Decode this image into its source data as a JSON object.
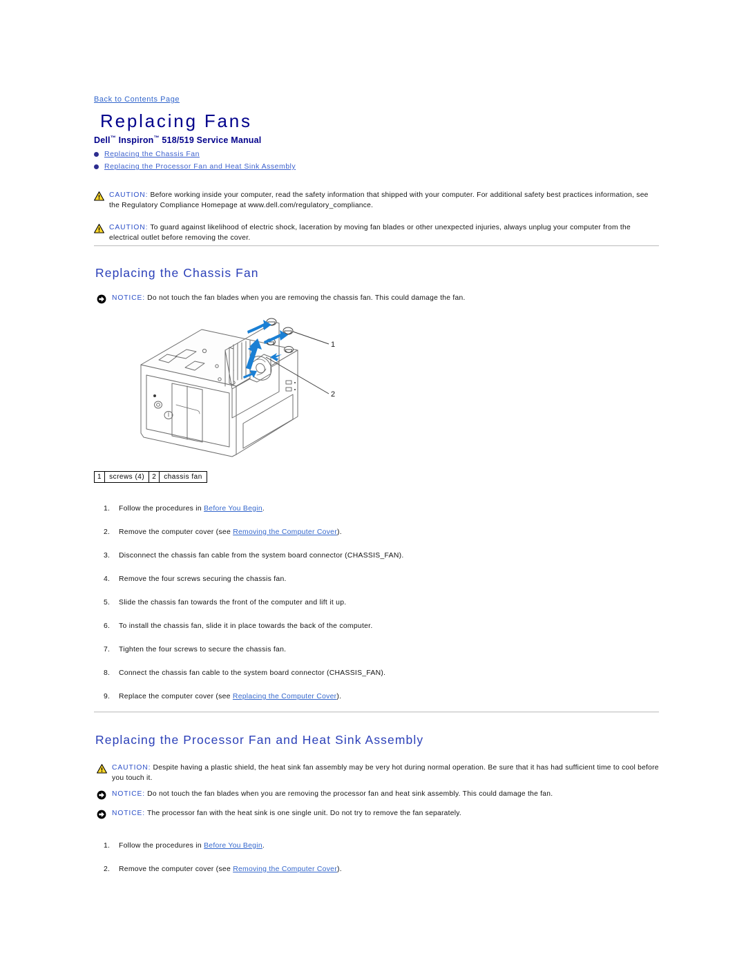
{
  "nav": {
    "back_link": "Back to Contents Page"
  },
  "header": {
    "title": "Replacing Fans",
    "subtitle_prefix": "Dell",
    "subtitle_tm1": "™",
    "subtitle_mid": " Inspiron",
    "subtitle_tm2": "™",
    "subtitle_suffix": " 518/519 Service Manual"
  },
  "toc": {
    "items": [
      {
        "label": "Replacing the Chassis Fan"
      },
      {
        "label": "Replacing the Processor Fan and Heat Sink Assembly"
      }
    ]
  },
  "admonitions": {
    "top": [
      {
        "type": "caution",
        "keyword": "CAUTION:",
        "text": " Before working inside your computer, read the safety information that shipped with your computer. For additional safety best practices information, see the Regulatory Compliance Homepage at www.dell.com/regulatory_compliance."
      },
      {
        "type": "caution",
        "keyword": "CAUTION:",
        "text": " To guard against likelihood of electric shock, laceration by moving fan blades or other unexpected injuries, always unplug your computer from the electrical outlet before removing the cover."
      }
    ],
    "chassis_notice": {
      "type": "notice",
      "keyword": "NOTICE:",
      "text": " Do not touch the fan blades when you are removing the chassis fan. This could damage the fan."
    },
    "processor_caution": {
      "type": "caution",
      "keyword": "CAUTION:",
      "text": " Despite having a plastic shield, the heat sink fan assembly may be very hot during normal operation. Be sure that it has had sufficient time to cool before you touch it."
    },
    "processor_notice_1": {
      "type": "notice",
      "keyword": "NOTICE:",
      "text": " Do not touch the fan blades when you are removing the processor fan and heat sink assembly. This could damage the fan."
    },
    "processor_notice_2": {
      "type": "notice",
      "keyword": "NOTICE:",
      "text": " The processor fan with the heat sink is one single unit. Do not try to remove the fan separately."
    }
  },
  "sections": {
    "chassis_fan": {
      "heading": "Replacing the Chassis Fan",
      "figure": {
        "callout_1": "1",
        "callout_2": "2",
        "legend": [
          {
            "num": "1",
            "label": "screws (4)"
          },
          {
            "num": "2",
            "label": "chassis fan"
          }
        ]
      },
      "steps": [
        {
          "n": "1.",
          "pre": "Follow the procedures in ",
          "link": "Before You Begin",
          "post": "."
        },
        {
          "n": "2.",
          "pre": "Remove the computer cover (see ",
          "link": "Removing the Computer Cover",
          "post": ")."
        },
        {
          "n": "3.",
          "pre": "Disconnect the chassis fan cable from the system board connector (CHASSIS_FAN).",
          "link": "",
          "post": ""
        },
        {
          "n": "4.",
          "pre": "Remove the four screws securing the chassis fan.",
          "link": "",
          "post": ""
        },
        {
          "n": "5.",
          "pre": "Slide the chassis fan towards the front of the computer and lift it up.",
          "link": "",
          "post": ""
        },
        {
          "n": "6.",
          "pre": "To install the chassis fan, slide it in place towards the back of the computer.",
          "link": "",
          "post": ""
        },
        {
          "n": "7.",
          "pre": "Tighten the four screws to secure the chassis fan.",
          "link": "",
          "post": ""
        },
        {
          "n": "8.",
          "pre": "Connect the chassis fan cable to the system board connector (CHASSIS_FAN).",
          "link": "",
          "post": ""
        },
        {
          "n": "9.",
          "pre": "Replace the computer cover (see ",
          "link": "Replacing the Computer Cover",
          "post": ")."
        }
      ]
    },
    "processor_fan": {
      "heading": "Replacing the Processor Fan and Heat Sink Assembly",
      "steps": [
        {
          "n": "1.",
          "pre": "Follow the procedures in ",
          "link": "Before You Begin",
          "post": "."
        },
        {
          "n": "2.",
          "pre": "Remove the computer cover (see ",
          "link": "Removing the Computer Cover",
          "post": ")."
        }
      ]
    }
  },
  "colors": {
    "title_navy": "#00008B",
    "section_blue": "#2a3fb8",
    "link_blue": "#3366CC",
    "keyword_blue": "#2b4fc8",
    "caution_yellow": "#FFD92B",
    "arrow_blue": "#1a7fd4",
    "rule_gray": "#c8c8c8"
  }
}
